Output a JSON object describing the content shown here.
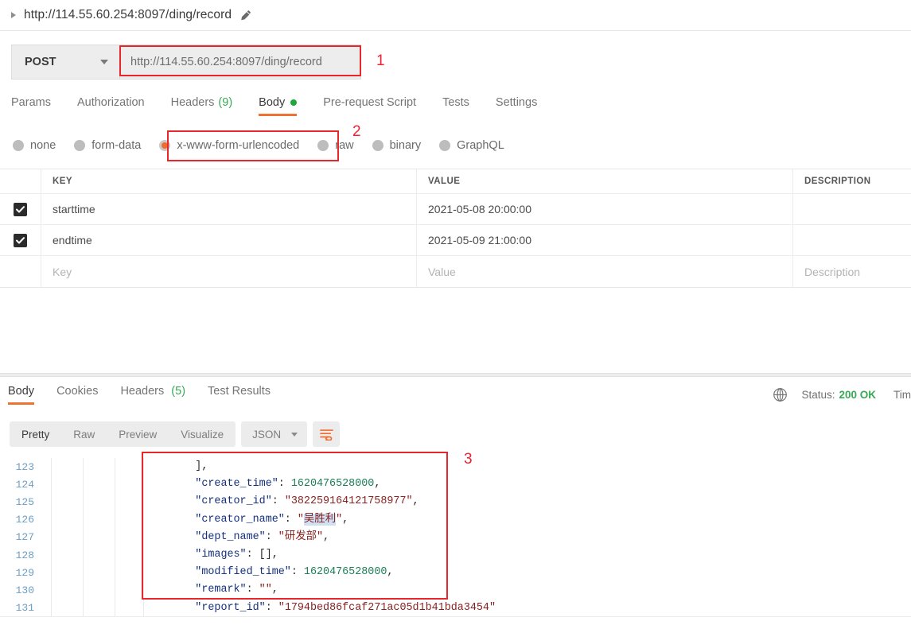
{
  "titlebar": {
    "expand_icon": "triangle-right-icon",
    "title": "http://114.55.60.254:8097/ding/record",
    "edit_icon": "pencil-icon"
  },
  "urlbar": {
    "method": "POST",
    "method_caret": "chevron-down-icon",
    "url": "http://114.55.60.254:8097/ding/record"
  },
  "annotations": [
    {
      "label": "1",
      "color": "#ef2233"
    },
    {
      "label": "2",
      "color": "#ef2233"
    },
    {
      "label": "3",
      "color": "#ef2233"
    }
  ],
  "request_tabs": [
    {
      "label": "Params",
      "count": "",
      "active": false
    },
    {
      "label": "Authorization",
      "count": "",
      "active": false
    },
    {
      "label": "Headers",
      "count": "(9)",
      "active": false
    },
    {
      "label": "Body",
      "count": "",
      "active": true,
      "dot": true
    },
    {
      "label": "Pre-request Script",
      "count": "",
      "active": false
    },
    {
      "label": "Tests",
      "count": "",
      "active": false
    },
    {
      "label": "Settings",
      "count": "",
      "active": false
    }
  ],
  "body_types": [
    {
      "label": "none",
      "selected": false
    },
    {
      "label": "form-data",
      "selected": false
    },
    {
      "label": "x-www-form-urlencoded",
      "selected": true
    },
    {
      "label": "raw",
      "selected": false
    },
    {
      "label": "binary",
      "selected": false
    },
    {
      "label": "GraphQL",
      "selected": false
    }
  ],
  "params_table": {
    "headers": {
      "key": "KEY",
      "value": "VALUE",
      "description": "DESCRIPTION"
    },
    "rows": [
      {
        "checked": true,
        "key": "starttime",
        "value": "2021-05-08 20:00:00",
        "description": ""
      },
      {
        "checked": true,
        "key": "endtime",
        "value": "2021-05-09 21:00:00",
        "description": ""
      }
    ],
    "placeholder_row": {
      "key": "Key",
      "value": "Value",
      "description": "Description"
    }
  },
  "response_tabs": [
    {
      "label": "Body",
      "count": "",
      "active": true
    },
    {
      "label": "Cookies",
      "count": "",
      "active": false
    },
    {
      "label": "Headers",
      "count": "(5)",
      "active": false
    },
    {
      "label": "Test Results",
      "count": "",
      "active": false
    }
  ],
  "response_status": {
    "globe_icon": "globe-icon",
    "status_label": "Status:",
    "status_code": "200 OK",
    "time_label": "Tim"
  },
  "response_toolbar": {
    "views": [
      {
        "label": "Pretty",
        "active": true
      },
      {
        "label": "Raw",
        "active": false
      },
      {
        "label": "Preview",
        "active": false
      },
      {
        "label": "Visualize",
        "active": false
      }
    ],
    "format": "JSON",
    "format_caret": "chevron-down-icon",
    "wrap_icon": "word-wrap-icon"
  },
  "code": {
    "lines": [
      {
        "no": "123",
        "tokens": [
          {
            "t": "        ",
            "c": "p"
          },
          {
            "t": "],",
            "c": "p"
          }
        ]
      },
      {
        "no": "124",
        "tokens": [
          {
            "t": "        ",
            "c": "p"
          },
          {
            "t": "\"create_time\"",
            "c": "k"
          },
          {
            "t": ": ",
            "c": "p"
          },
          {
            "t": "1620476528000",
            "c": "n"
          },
          {
            "t": ",",
            "c": "p"
          }
        ]
      },
      {
        "no": "125",
        "tokens": [
          {
            "t": "        ",
            "c": "p"
          },
          {
            "t": "\"creator_id\"",
            "c": "k"
          },
          {
            "t": ": ",
            "c": "p"
          },
          {
            "t": "\"382259164121758977\"",
            "c": "s"
          },
          {
            "t": ",",
            "c": "p"
          }
        ]
      },
      {
        "no": "126",
        "tokens": [
          {
            "t": "        ",
            "c": "p"
          },
          {
            "t": "\"creator_name\"",
            "c": "k"
          },
          {
            "t": ": ",
            "c": "p"
          },
          {
            "t": "\"",
            "c": "s"
          },
          {
            "t": "吴胜利",
            "c": "s hi"
          },
          {
            "t": "\"",
            "c": "s"
          },
          {
            "t": ",",
            "c": "p"
          }
        ]
      },
      {
        "no": "127",
        "tokens": [
          {
            "t": "        ",
            "c": "p"
          },
          {
            "t": "\"dept_name\"",
            "c": "k"
          },
          {
            "t": ": ",
            "c": "p"
          },
          {
            "t": "\"研发部\"",
            "c": "s"
          },
          {
            "t": ",",
            "c": "p"
          }
        ]
      },
      {
        "no": "128",
        "tokens": [
          {
            "t": "        ",
            "c": "p"
          },
          {
            "t": "\"images\"",
            "c": "k"
          },
          {
            "t": ": ",
            "c": "p"
          },
          {
            "t": "[],",
            "c": "p"
          }
        ]
      },
      {
        "no": "129",
        "tokens": [
          {
            "t": "        ",
            "c": "p"
          },
          {
            "t": "\"modified_time\"",
            "c": "k"
          },
          {
            "t": ": ",
            "c": "p"
          },
          {
            "t": "1620476528000",
            "c": "n"
          },
          {
            "t": ",",
            "c": "p"
          }
        ]
      },
      {
        "no": "130",
        "tokens": [
          {
            "t": "        ",
            "c": "p"
          },
          {
            "t": "\"remark\"",
            "c": "k"
          },
          {
            "t": ": ",
            "c": "p"
          },
          {
            "t": "\"\"",
            "c": "s"
          },
          {
            "t": ",",
            "c": "p"
          }
        ]
      },
      {
        "no": "131",
        "tokens": [
          {
            "t": "        ",
            "c": "p"
          },
          {
            "t": "\"report_id\"",
            "c": "k"
          },
          {
            "t": ": ",
            "c": "p"
          },
          {
            "t": "\"1794bed86fcaf271ac05d1b41bda3454\"",
            "c": "s"
          }
        ]
      }
    ]
  }
}
